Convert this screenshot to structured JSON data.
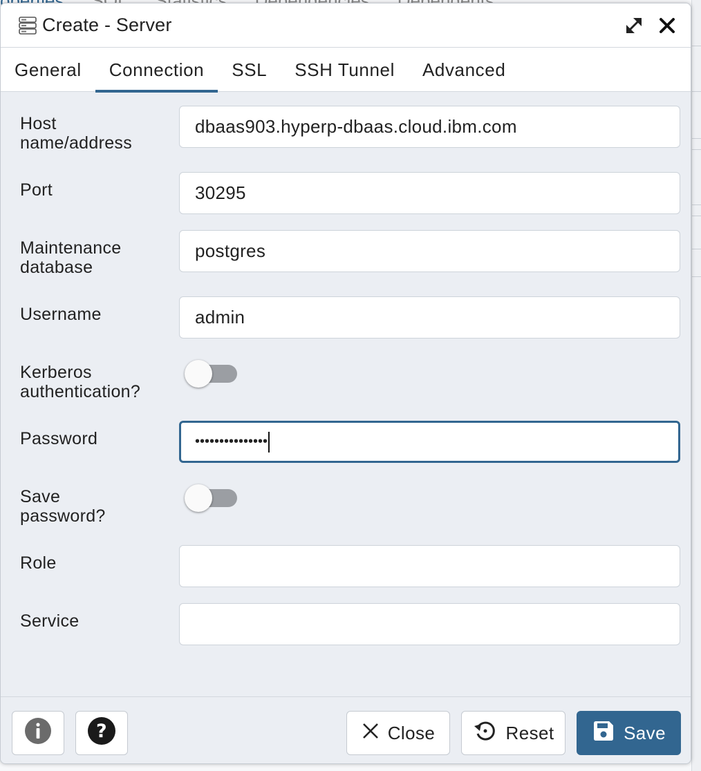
{
  "background": {
    "tabs": [
      "operties",
      "SQL",
      "Statistics",
      "Dependencies",
      "Dependents"
    ]
  },
  "dialog": {
    "title": "Create - Server",
    "icons": {
      "title": "server-icon",
      "expand": "expand-icon",
      "close": "close-icon"
    }
  },
  "tabs": [
    {
      "label": "General",
      "active": false
    },
    {
      "label": "Connection",
      "active": true
    },
    {
      "label": "SSL",
      "active": false
    },
    {
      "label": "SSH Tunnel",
      "active": false
    },
    {
      "label": "Advanced",
      "active": false
    }
  ],
  "form": {
    "host": {
      "label_line1": "Host",
      "label_line2": "name/address",
      "value": "dbaas903.hyperp-dbaas.cloud.ibm.com"
    },
    "port": {
      "label": "Port",
      "value": "30295"
    },
    "maintenance_db": {
      "label_line1": "Maintenance",
      "label_line2": "database",
      "value": "postgres"
    },
    "username": {
      "label": "Username",
      "value": "admin"
    },
    "kerberos": {
      "label_line1": "Kerberos",
      "label_line2": "authentication?",
      "enabled": false
    },
    "password": {
      "label": "Password",
      "value": "•••••••••••••••"
    },
    "save_password": {
      "label_line1": "Save",
      "label_line2": "password?",
      "enabled": false
    },
    "role": {
      "label": "Role",
      "value": ""
    },
    "service": {
      "label": "Service",
      "value": ""
    }
  },
  "footer": {
    "info_icon": "info-icon",
    "help_icon": "help-icon",
    "close_label": "Close",
    "reset_label": "Reset",
    "save_label": "Save"
  },
  "colors": {
    "primary": "#326690",
    "dialog_bg": "#ebeef3",
    "toggle_off": "#9b9ea3"
  }
}
